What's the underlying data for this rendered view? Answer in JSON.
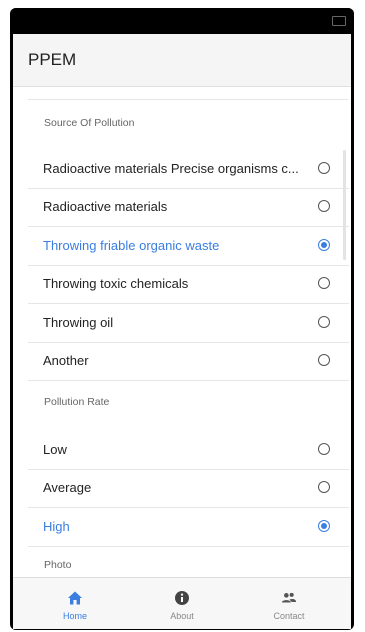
{
  "app": {
    "title": "PPEM"
  },
  "sections": {
    "source": {
      "header": "Source Of Pollution",
      "options": [
        {
          "label": "Radioactive materials Precise organisms c...",
          "selected": false
        },
        {
          "label": "Radioactive materials",
          "selected": false
        },
        {
          "label": "Throwing friable organic waste",
          "selected": true
        },
        {
          "label": "Throwing toxic chemicals",
          "selected": false
        },
        {
          "label": "Throwing oil",
          "selected": false
        },
        {
          "label": "Another",
          "selected": false
        }
      ]
    },
    "rate": {
      "header": "Pollution Rate",
      "options": [
        {
          "label": "Low",
          "selected": false
        },
        {
          "label": "Average",
          "selected": false
        },
        {
          "label": "High",
          "selected": true
        }
      ]
    },
    "photo": {
      "header": "Photo"
    }
  },
  "nav": {
    "items": [
      {
        "label": "Home",
        "icon": "home-icon",
        "active": true
      },
      {
        "label": "About",
        "icon": "info-icon",
        "active": false
      },
      {
        "label": "Contact",
        "icon": "contacts-icon",
        "active": false
      }
    ]
  },
  "colors": {
    "accent": "#3a7ee0",
    "appbar": "#f5f5f5",
    "text": "#222222",
    "muted": "#666666"
  }
}
